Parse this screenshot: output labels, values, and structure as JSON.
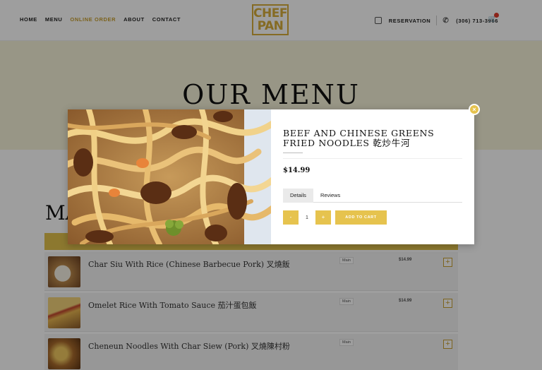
{
  "header": {
    "nav": [
      "HOME",
      "MENU",
      "ONLINE ORDER",
      "ABOUT",
      "CONTACT"
    ],
    "logo_line1": "CHEF",
    "logo_line2": "PAN",
    "reservation": "RESERVATION",
    "phone": "(306) 713-3966"
  },
  "hero": {
    "title": "OUR MENU"
  },
  "section": {
    "title": "MA"
  },
  "menu_rows": [
    {
      "name": "Char Siu With Rice (Chinese Barbecue Pork) 叉燒飯",
      "size": "Main",
      "price": "$14.99"
    },
    {
      "name": "Omelet Rice With Tomato Sauce 茄汁蛋包飯",
      "size": "Main",
      "price": "$14.99"
    },
    {
      "name": "Cheneun Noodles With Char Siew (Pork) 叉燒陳村粉",
      "size": "Main",
      "price": ""
    }
  ],
  "modal": {
    "title": "BEEF AND CHINESE GREENS FRIED NOODLES 乾炒牛河",
    "price": "$14.99",
    "tabs": [
      "Details",
      "Reviews"
    ],
    "qty_minus": "-",
    "qty_value": "1",
    "qty_plus": "+",
    "add_to_cart": "ADD TO CART",
    "close": "×"
  },
  "colors": {
    "accent": "#e6c34e",
    "active_nav": "#c9a030",
    "badge": "#e03a2a"
  }
}
